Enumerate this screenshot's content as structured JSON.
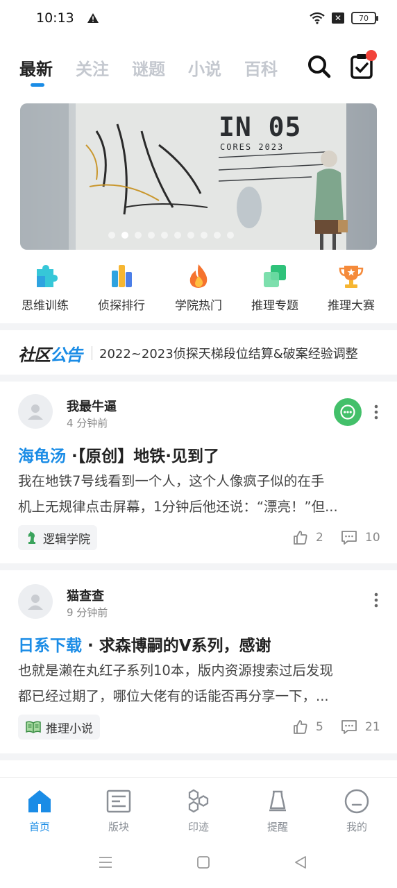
{
  "status_bar": {
    "time": "10:13",
    "battery": "70"
  },
  "top_tabs": [
    {
      "label": "最新",
      "active": true
    },
    {
      "label": "关注",
      "active": false
    },
    {
      "label": "谜题",
      "active": false
    },
    {
      "label": "小说",
      "active": false
    },
    {
      "label": "百科",
      "active": false
    }
  ],
  "banner": {
    "title": "IN 05",
    "subtitle": "CORES 2023",
    "slide_count": 10,
    "active_slide": 1
  },
  "quick_actions": [
    {
      "label": "思维训练",
      "icon": "puzzle-icon"
    },
    {
      "label": "侦探排行",
      "icon": "ranking-bars-icon"
    },
    {
      "label": "学院热门",
      "icon": "flame-icon"
    },
    {
      "label": "推理专题",
      "icon": "cards-icon"
    },
    {
      "label": "推理大赛",
      "icon": "trophy-icon"
    }
  ],
  "notice": {
    "brand_part1": "社区",
    "brand_part2": "公告",
    "text": "2022~2023侦探天梯段位结算&破案经验调整"
  },
  "posts": [
    {
      "author": "我最牛逼",
      "time": "4 分钟前",
      "category": "海龟汤",
      "title": " ·【原创】地铁·见到了",
      "body_line1": "我在地铁7号线看到一个人，这个人像疯子似的在手",
      "body_line2": "机上无规律点击屏幕，1分钟后他还说：“漂亮！”但...",
      "tag": "逻辑学院",
      "likes": "2",
      "comments": "10",
      "has_chat_badge": true
    },
    {
      "author": "猫查查",
      "time": "9 分钟前",
      "category": "日系下载",
      "title": " · 求森博嗣的V系列，感谢",
      "body_line1": "也就是濑在丸红子系列10本，版内资源搜索过后发现",
      "body_line2": "都已经过期了，哪位大佬有的话能否再分享一下，...",
      "tag": "推理小说",
      "likes": "5",
      "comments": "21",
      "has_chat_badge": false
    }
  ],
  "bottom_nav": [
    {
      "label": "首页",
      "icon": "home-icon",
      "active": true
    },
    {
      "label": "版块",
      "icon": "board-icon",
      "active": false
    },
    {
      "label": "印迹",
      "icon": "hexagons-icon",
      "active": false
    },
    {
      "label": "提醒",
      "icon": "bell-icon",
      "active": false
    },
    {
      "label": "我的",
      "icon": "profile-icon",
      "active": false
    }
  ],
  "colors": {
    "accent": "#1a8ce6",
    "badge_red": "#f2433a",
    "chat_green": "#43c06a"
  }
}
